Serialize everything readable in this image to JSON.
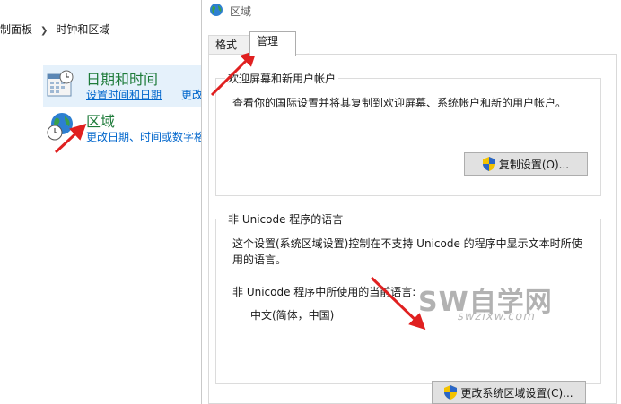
{
  "control_panel": {
    "breadcrumb": [
      "制面板",
      "时钟和区域"
    ],
    "items": [
      {
        "title": "日期和时间",
        "link1": "设置时间和日期",
        "link2": "更改"
      },
      {
        "title": "区域",
        "link1": "更改日期、时间或数字格"
      }
    ]
  },
  "dialog": {
    "title": "区域",
    "tabs": [
      {
        "label": "格式"
      },
      {
        "label": "管理"
      }
    ],
    "welcome": {
      "group_title": "欢迎屏幕和新用户帐户",
      "description": "查看你的国际设置并将其复制到欢迎屏幕、系统帐户和新的用户帐户。",
      "button": "复制设置(O)..."
    },
    "unicode": {
      "group_title": "非 Unicode 程序的语言",
      "description_line1": "这个设置(系统区域设置)控制在不支持 Unicode 的程序中显示文本时所使",
      "description_line2": "用的语言。",
      "current_label": "非 Unicode 程序中所使用的当前语言:",
      "current_value": "中文(简体，中国)",
      "button": "更改系统区域设置(C)..."
    }
  },
  "watermark": {
    "main": "SW自学网",
    "sub": "swzixw.com"
  },
  "colors": {
    "link": "#0066cc",
    "title_green": "#1e7b3a",
    "arrow": "#e02020"
  }
}
